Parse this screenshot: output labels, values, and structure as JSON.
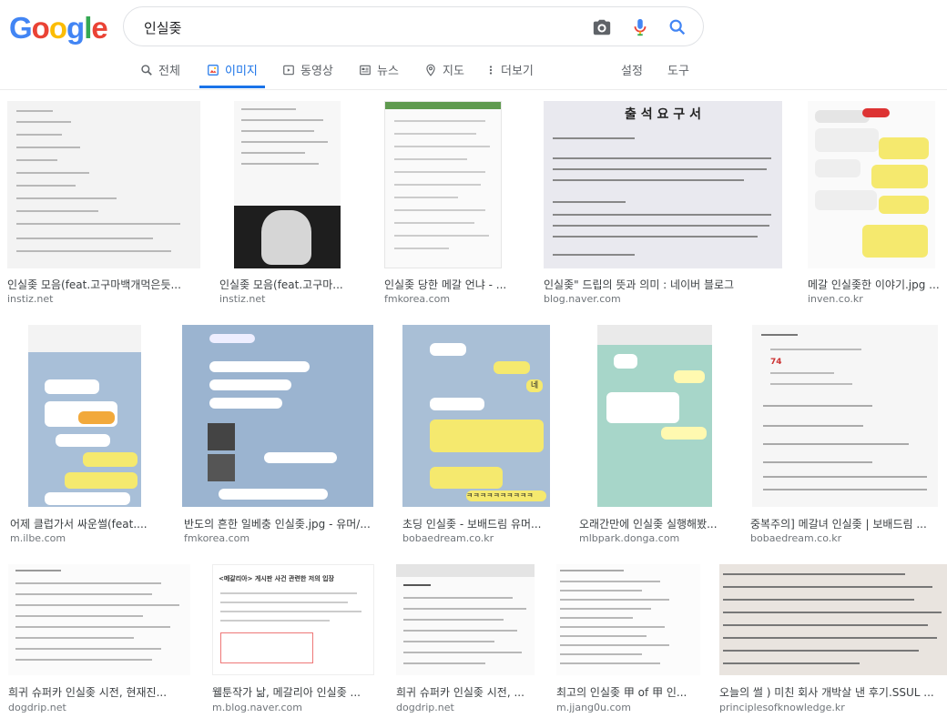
{
  "logo": {
    "letters": [
      "G",
      "o",
      "o",
      "g",
      "l",
      "e"
    ],
    "colors": [
      "#4285F4",
      "#EA4335",
      "#FBBC05",
      "#4285F4",
      "#34A853",
      "#EA4335"
    ]
  },
  "search": {
    "query": "인실좆",
    "camera_icon": "camera-icon",
    "mic_icon": "mic-icon",
    "search_icon": "search-icon"
  },
  "tabs": {
    "all": "전체",
    "images": "이미지",
    "videos": "동영상",
    "news": "뉴스",
    "maps": "지도",
    "more": "더보기",
    "settings": "설정",
    "tools": "도구",
    "active": "이미지"
  },
  "results": [
    {
      "title": "인실좆 모음(feat.고구마백개먹은듯...",
      "source": "instiz.net"
    },
    {
      "title": "인실좆 모음(feat.고구마...",
      "source": "instiz.net"
    },
    {
      "title": "인실좆 당한 메갈 언냐 - ...",
      "source": "fmkorea.com"
    },
    {
      "title": "인실좆\" 드립의 뜻과 의미 : 네이버 블로그",
      "source": "blog.naver.com"
    },
    {
      "title": "메갈 인실좆한 이야기.jpg ...",
      "source": "inven.co.kr"
    },
    {
      "title": "어제 클럽가서 싸운썰(feat....",
      "source": "m.ilbe.com"
    },
    {
      "title": "반도의 흔한 일베충 인실좆.jpg - 유머/...",
      "source": "fmkorea.com"
    },
    {
      "title": "초딩 인실좆 - 보배드림 유머...",
      "source": "bobaedream.co.kr"
    },
    {
      "title": "오래간만에 인실좆 실행해봤...",
      "source": "mlbpark.donga.com"
    },
    {
      "title": "중복주의] 메갈녀 인실좆 | 보배드림 ...",
      "source": "bobaedream.co.kr"
    },
    {
      "title": "희귀 슈퍼카 인실좆 시전, 현재진...",
      "source": "dogdrip.net"
    },
    {
      "title": "웰툰작가 낢, 메갈리아 인실좆 ...",
      "source": "m.blog.naver.com"
    },
    {
      "title": "희귀 슈퍼카 인실좆 시전, ...",
      "source": "dogdrip.net"
    },
    {
      "title": "최고의 인실좆 甲 of 甲 인...",
      "source": "m.jjang0u.com"
    },
    {
      "title": "오늘의 썰 ) 미친 회사 개박살 낸 후기.SSUL ...",
      "source": "principlesofknowledge.kr"
    }
  ],
  "thumb_text": {
    "doc_title": "출 석 요 구 서",
    "notice_heading": "<메갈리아> 게시판 사건 관련한 저의 입장",
    "stat_count": "74",
    "bubble_a": "네",
    "bubble_b": "ㅋㅋㅋㅋㅋㅋㅋㅋㅋㅋ"
  }
}
